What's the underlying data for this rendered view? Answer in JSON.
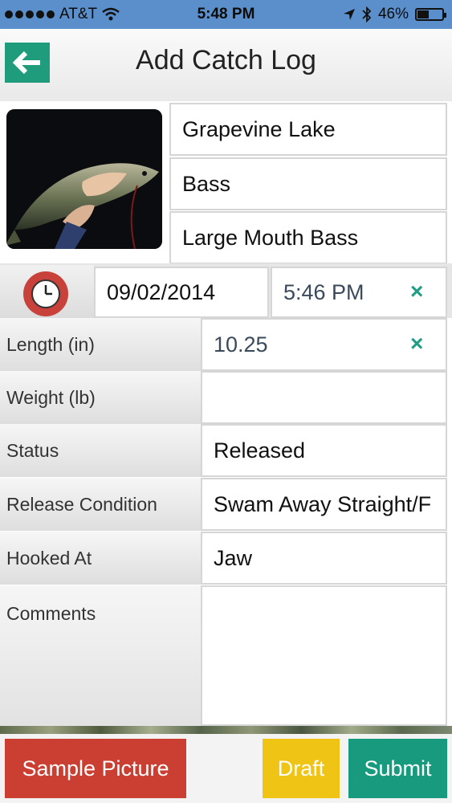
{
  "status_bar": {
    "carrier": "AT&T",
    "time": "5:48 PM",
    "battery_percent_label": "46%",
    "battery_level": 0.46
  },
  "header": {
    "title": "Add Catch Log",
    "back_icon": "arrow-left-icon"
  },
  "catch": {
    "location": "Grapevine Lake",
    "species": "Bass",
    "subspecies": "Large Mouth Bass",
    "date": "09/02/2014",
    "time": "5:46 PM",
    "clear_icon": "×"
  },
  "form": {
    "length_label": "Length (in)",
    "length_value": "10.25",
    "weight_label": "Weight (lb)",
    "weight_value": "",
    "status_label": "Status",
    "status_value": "Released",
    "release_label": "Release Condition",
    "release_value": "Swam Away Straight/F",
    "hooked_label": "Hooked At",
    "hooked_value": "Jaw",
    "comments_label": "Comments",
    "comments_value": ""
  },
  "buttons": {
    "sample_picture": "Sample Picture",
    "draft": "Draft",
    "submit": "Submit"
  },
  "colors": {
    "accent_green": "#1e9c7c",
    "red": "#cb3e32",
    "yellow": "#f0c414"
  }
}
